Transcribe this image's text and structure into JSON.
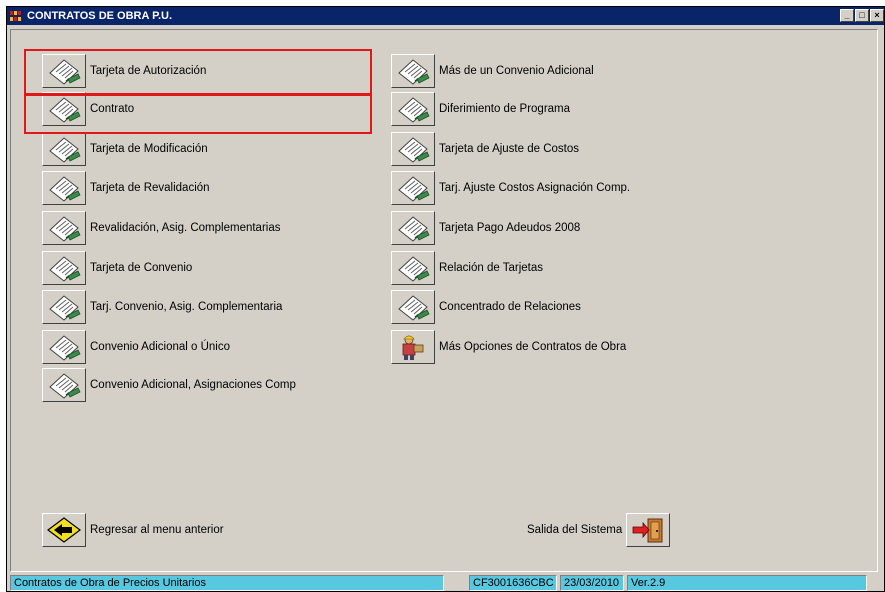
{
  "window": {
    "title": "CONTRATOS DE OBRA P.U."
  },
  "menu_left": [
    {
      "label": "Tarjeta de Autorización"
    },
    {
      "label": "Contrato"
    },
    {
      "label": "Tarjeta de Modificación"
    },
    {
      "label": "Tarjeta de Revalidación"
    },
    {
      "label": "Revalidación, Asig. Complementarias"
    },
    {
      "label": "Tarjeta de Convenio"
    },
    {
      "label": "Tarj. Convenio, Asig. Complementaria"
    },
    {
      "label": "Convenio Adicional o Único"
    },
    {
      "label": "Convenio Adicional, Asignaciones Comp"
    }
  ],
  "menu_right": [
    {
      "label": "Más de un Convenio Adicional"
    },
    {
      "label": "Diferimiento de Programa"
    },
    {
      "label": "Tarjeta de Ajuste de Costos"
    },
    {
      "label": "Tarj. Ajuste Costos Asignación Comp."
    },
    {
      "label": "Tarjeta Pago Adeudos 2008"
    },
    {
      "label": "Relación de Tarjetas"
    },
    {
      "label": "Concentrado de Relaciones"
    },
    {
      "label": "Más Opciones de Contratos de Obra"
    }
  ],
  "footer": {
    "back_label": "Regresar al menu anterior",
    "exit_label": "Salida del Sistema"
  },
  "status": {
    "app": "Contratos de Obra de Precios Unitarios",
    "code": "CF3001636CBC",
    "date": "23/03/2010",
    "version": "Ver.2.9"
  },
  "colors": {
    "highlight": "#e01818",
    "titlebar": "#0a246a",
    "statusbar": "#58c8e0"
  }
}
